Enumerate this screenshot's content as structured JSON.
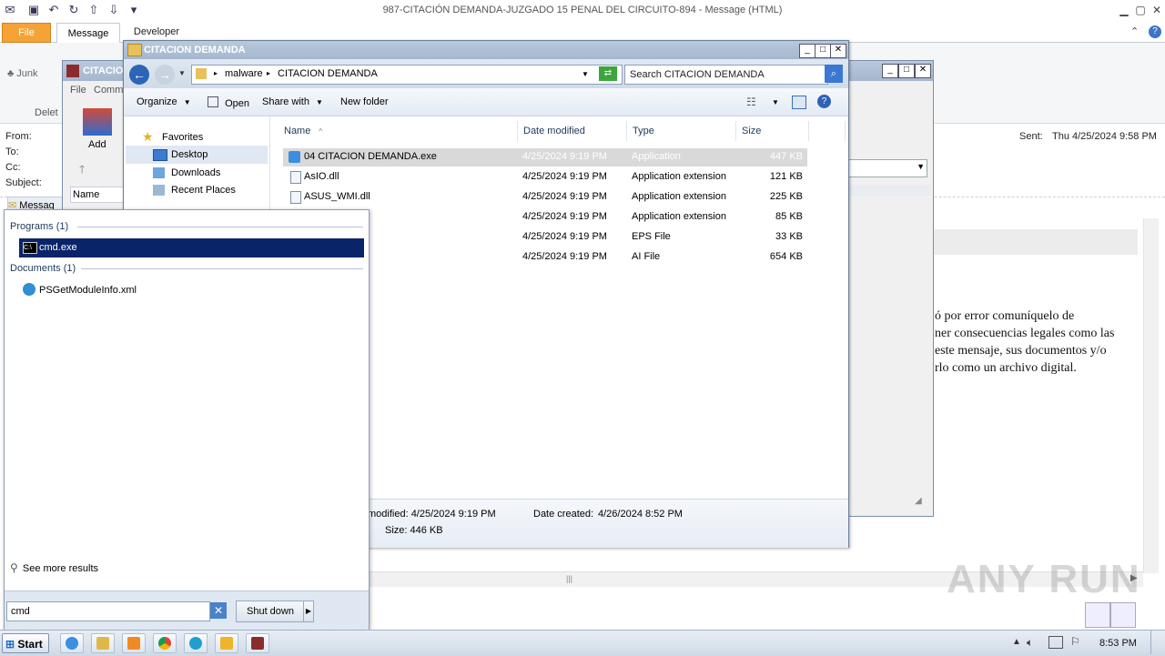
{
  "outlook": {
    "title": "987-CITACIÓN  DEMANDA-JUZGADO 15 PENAL DEL CIRCUITO-894 -  Message (HTML)",
    "tabs": [
      "File",
      "Message",
      "Developer"
    ],
    "ribbon_junk": "Junk",
    "ribbon_delete": "Delet",
    "from_label": "From:",
    "to_label": "To:",
    "cc_label": "Cc:",
    "subject_label": "Subject:",
    "sent_label": "Sent:",
    "sent_value": "Thu 4/25/2024 9:58 PM",
    "message_tab": "Messag",
    "body_lines": [
      "ó por error comuníquelo de",
      "ner consecuencias legales como las",
      "este mensaje, sus documentos y/o",
      "rlo como un archivo digital."
    ]
  },
  "zip": {
    "title": "CITACIO",
    "menu": [
      "File",
      "Comm"
    ],
    "add_label": "Add",
    "name_col": "Name"
  },
  "explorer": {
    "title": "CITACION DEMANDA",
    "breadcrumb": [
      "malware",
      "CITACION DEMANDA"
    ],
    "search_placeholder": "Search CITACION DEMANDA",
    "toolbar": [
      "Organize",
      "Open",
      "Share with",
      "New folder"
    ],
    "nav": {
      "favorites": "Favorites",
      "items": [
        "Desktop",
        "Downloads",
        "Recent Places"
      ]
    },
    "columns": [
      "Name",
      "Date modified",
      "Type",
      "Size"
    ],
    "files": [
      {
        "name": "04 CITACION DEMANDA.exe",
        "date": "4/25/2024 9:19 PM",
        "type": "Application",
        "size": "447 KB"
      },
      {
        "name": "AsIO.dll",
        "date": "4/25/2024 9:19 PM",
        "type": "Application extension",
        "size": "121 KB"
      },
      {
        "name": "ASUS_WMI.dll",
        "date": "4/25/2024 9:19 PM",
        "type": "Application extension",
        "size": "225 KB"
      },
      {
        "name": "",
        "date": "4/25/2024 9:19 PM",
        "type": "Application extension",
        "size": "85 KB"
      },
      {
        "name": "",
        "date": "4/25/2024 9:19 PM",
        "type": "EPS File",
        "size": "33 KB"
      },
      {
        "name": "",
        "date": "4/25/2024 9:19 PM",
        "type": "AI File",
        "size": "654 KB"
      }
    ],
    "details": {
      "modified": "modified: 4/25/2024 9:19 PM",
      "created_label": "Date created:",
      "created_value": "4/26/2024 8:52 PM",
      "size": "Size: 446 KB"
    }
  },
  "start_menu": {
    "programs_header": "Programs (1)",
    "program_item": "cmd.exe",
    "documents_header": "Documents (1)",
    "document_item": "PSGetModuleInfo.xml",
    "see_more": "See more results",
    "search_value": "cmd",
    "shutdown_label": "Shut down"
  },
  "taskbar": {
    "start_label": "Start",
    "clock": "8:53 PM"
  },
  "watermark": "ANY RUN",
  "colors": {
    "file_tab": "#f5a336",
    "selection": "#0a246a",
    "explorer_title": "#a5b7cd"
  }
}
